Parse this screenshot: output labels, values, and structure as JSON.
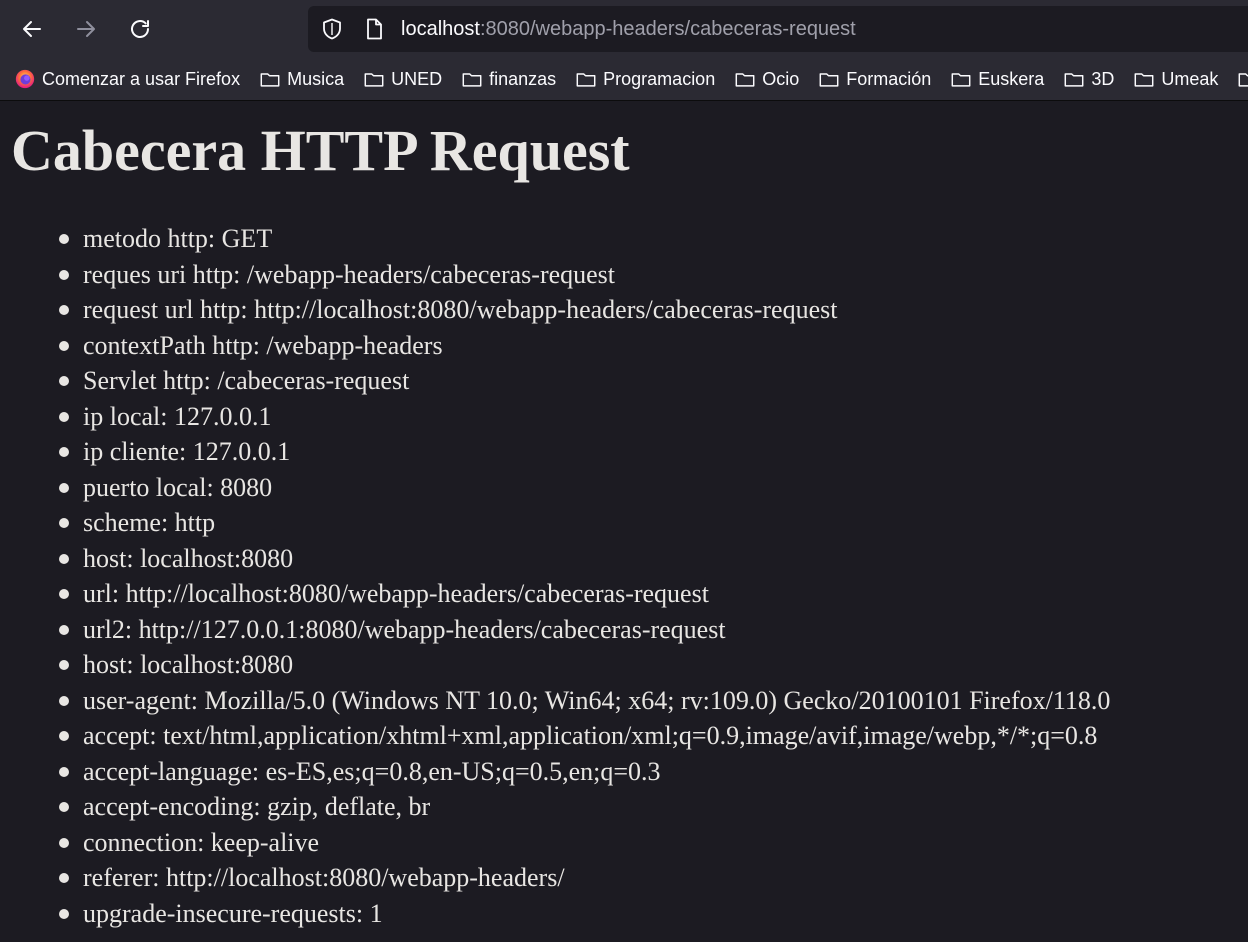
{
  "browser": {
    "url_host": "localhost",
    "url_rest": ":8080/webapp-headers/cabeceras-request",
    "bookmarks": [
      {
        "label": "Comenzar a usar Firefox",
        "icon": "firefox-icon"
      },
      {
        "label": "Musica",
        "icon": "folder-icon"
      },
      {
        "label": "UNED",
        "icon": "folder-icon"
      },
      {
        "label": "finanzas",
        "icon": "folder-icon"
      },
      {
        "label": "Programacion",
        "icon": "folder-icon"
      },
      {
        "label": "Ocio",
        "icon": "folder-icon"
      },
      {
        "label": "Formación",
        "icon": "folder-icon"
      },
      {
        "label": "Euskera",
        "icon": "folder-icon"
      },
      {
        "label": "3D",
        "icon": "folder-icon"
      },
      {
        "label": "Umeak",
        "icon": "folder-icon"
      },
      {
        "label": "",
        "icon": "folder-icon"
      }
    ]
  },
  "page": {
    "title": "Cabecera HTTP Request",
    "items": [
      "metodo http: GET",
      "reques uri http: /webapp-headers/cabeceras-request",
      "request url http: http://localhost:8080/webapp-headers/cabeceras-request",
      "contextPath http: /webapp-headers",
      "Servlet http: /cabeceras-request",
      "ip local: 127.0.0.1",
      "ip cliente: 127.0.0.1",
      "puerto local: 8080",
      "scheme: http",
      "host: localhost:8080",
      "url: http://localhost:8080/webapp-headers/cabeceras-request",
      "url2: http://127.0.0.1:8080/webapp-headers/cabeceras-request",
      "host: localhost:8080",
      "user-agent: Mozilla/5.0 (Windows NT 10.0; Win64; x64; rv:109.0) Gecko/20100101 Firefox/118.0",
      "accept: text/html,application/xhtml+xml,application/xml;q=0.9,image/avif,image/webp,*/*;q=0.8",
      "accept-language: es-ES,es;q=0.8,en-US;q=0.5,en;q=0.3",
      "accept-encoding: gzip, deflate, br",
      "connection: keep-alive",
      "referer: http://localhost:8080/webapp-headers/",
      "upgrade-insecure-requests: 1"
    ]
  },
  "colors": {
    "toolbar_bg": "#2b2a33",
    "page_bg": "#1c1b22",
    "page_text": "#e8e6e3",
    "url_muted": "#a0a0ab"
  }
}
